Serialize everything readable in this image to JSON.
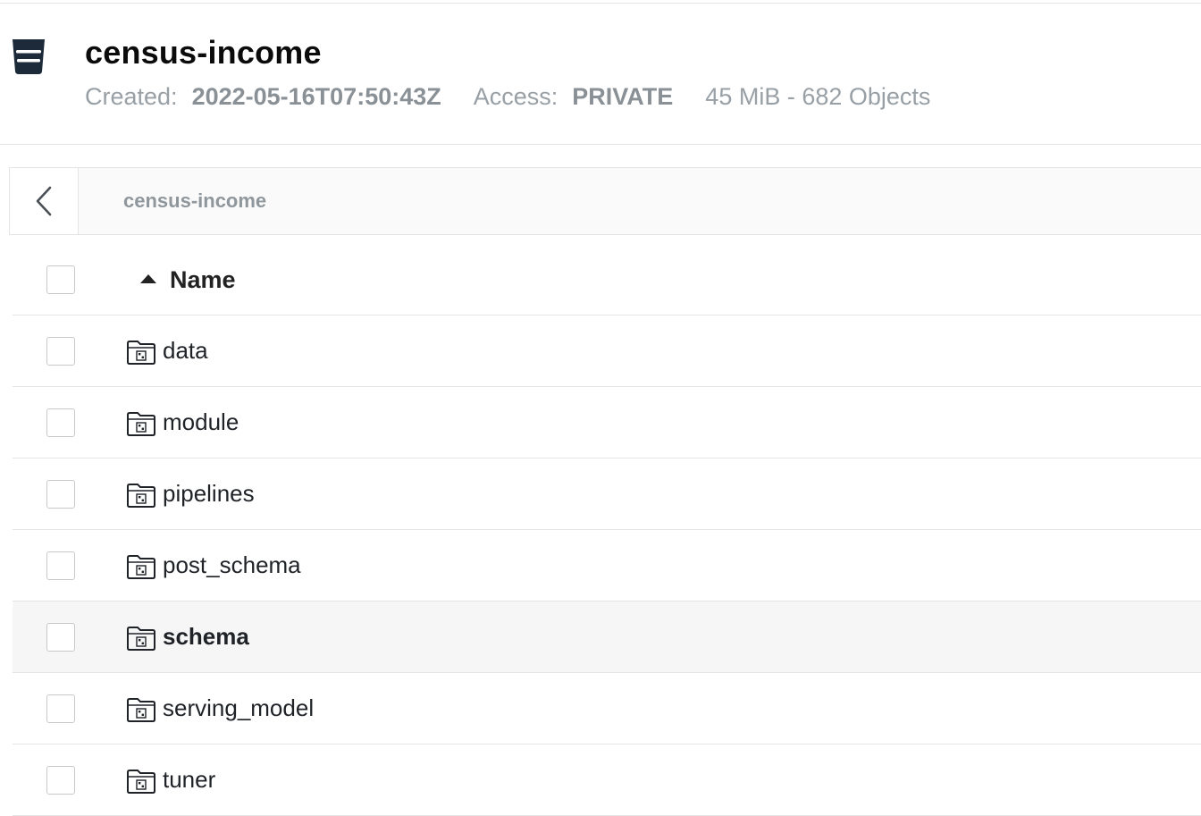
{
  "bucket": {
    "name": "census-income",
    "created_label": "Created:",
    "created_value": "2022-05-16T07:50:43Z",
    "access_label": "Access:",
    "access_value": "PRIVATE",
    "size_summary": "45 MiB - 682 Objects",
    "icon": "bucket-icon",
    "icon_color": "#1c2a3a"
  },
  "breadcrumb": {
    "path": "census-income",
    "back_icon": "chevron-left-icon"
  },
  "table": {
    "name_column": "Name",
    "sort_direction": "ascending",
    "rows": [
      {
        "name": "data",
        "type": "folder",
        "selected": false
      },
      {
        "name": "module",
        "type": "folder",
        "selected": false
      },
      {
        "name": "pipelines",
        "type": "folder",
        "selected": false
      },
      {
        "name": "post_schema",
        "type": "folder",
        "selected": false
      },
      {
        "name": "schema",
        "type": "folder",
        "selected": true
      },
      {
        "name": "serving_model",
        "type": "folder",
        "selected": false
      },
      {
        "name": "tuner",
        "type": "folder",
        "selected": false
      }
    ]
  }
}
